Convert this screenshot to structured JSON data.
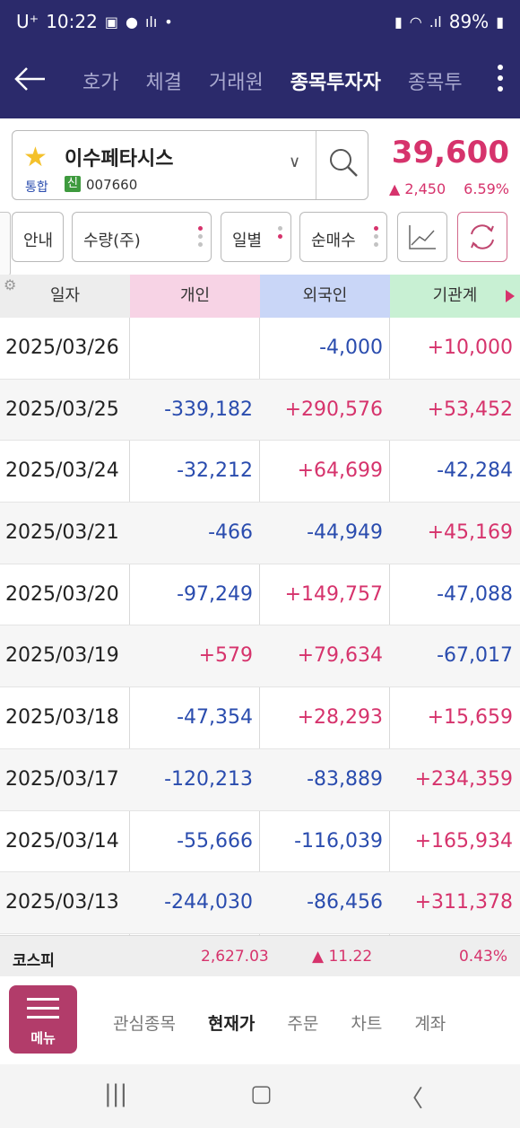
{
  "status_bar": {
    "carrier": "U⁺",
    "time": "10:22",
    "battery": "89%"
  },
  "nav": {
    "tabs": [
      {
        "label": "호가",
        "active": false
      },
      {
        "label": "체결",
        "active": false
      },
      {
        "label": "거래원",
        "active": false
      },
      {
        "label": "종목투자자",
        "active": true
      },
      {
        "label": "종목투",
        "active": false
      }
    ]
  },
  "stock": {
    "name": "이수페타시스",
    "market": "통합",
    "badge": "신",
    "code": "007660",
    "price": "39,600",
    "change": "▲ 2,450",
    "change_pct": "6.59%"
  },
  "filters": {
    "info": "안내",
    "quantity": "수량(주)",
    "period": "일별",
    "net_buy": "순매수"
  },
  "table": {
    "headers": {
      "date": "일자",
      "individual": "개인",
      "foreign": "외국인",
      "institution": "기관계"
    },
    "rows": [
      {
        "date": "2025/03/26",
        "individual": "",
        "foreign": "-4,000",
        "institution": "+10,000"
      },
      {
        "date": "2025/03/25",
        "individual": "-339,182",
        "foreign": "+290,576",
        "institution": "+53,452"
      },
      {
        "date": "2025/03/24",
        "individual": "-32,212",
        "foreign": "+64,699",
        "institution": "-42,284"
      },
      {
        "date": "2025/03/21",
        "individual": "-466",
        "foreign": "-44,949",
        "institution": "+45,169"
      },
      {
        "date": "2025/03/20",
        "individual": "-97,249",
        "foreign": "+149,757",
        "institution": "-47,088"
      },
      {
        "date": "2025/03/19",
        "individual": "+579",
        "foreign": "+79,634",
        "institution": "-67,017"
      },
      {
        "date": "2025/03/18",
        "individual": "-47,354",
        "foreign": "+28,293",
        "institution": "+15,659"
      },
      {
        "date": "2025/03/17",
        "individual": "-120,213",
        "foreign": "-83,889",
        "institution": "+234,359"
      },
      {
        "date": "2025/03/14",
        "individual": "-55,666",
        "foreign": "-116,039",
        "institution": "+165,934"
      },
      {
        "date": "2025/03/13",
        "individual": "-244,030",
        "foreign": "-86,456",
        "institution": "+311,378"
      }
    ]
  },
  "index_bar": {
    "name": "코스피",
    "value": "2,627.03",
    "change": "▲ 11.22",
    "change_pct": "0.43%"
  },
  "bottom_menu": {
    "menu_label": "메뉴",
    "tabs": [
      {
        "label": "관심종목",
        "active": false
      },
      {
        "label": "현재가",
        "active": true
      },
      {
        "label": "주문",
        "active": false
      },
      {
        "label": "차트",
        "active": false
      },
      {
        "label": "계좌",
        "active": false
      }
    ]
  },
  "colors": {
    "up": "#d6336c",
    "down": "#2a4cae",
    "header_bg": "#2b2a6b",
    "menu_bg": "#b23c6a"
  }
}
